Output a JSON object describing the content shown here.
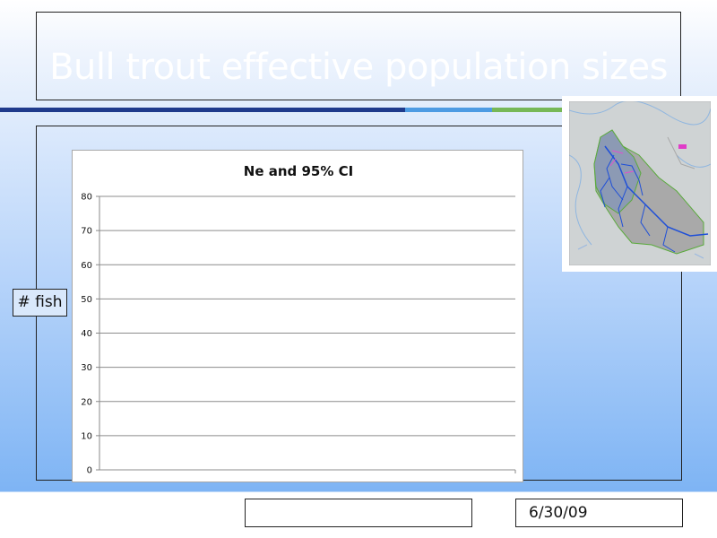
{
  "slide": {
    "title": "Bull trout effective population sizes",
    "ylabel_callout": "# fish",
    "footer_text": "",
    "date": "6/30/09"
  },
  "colors": {
    "title_text": "#ffffff",
    "rule_dark": "#1f3a8c",
    "rule_mid": "#4d9be3",
    "rule_green": "#77b857",
    "gridline": "#8c8c8c"
  },
  "map": {
    "icon": "watershed-map-image"
  },
  "chart_data": {
    "type": "bar",
    "title": "Ne and 95% CI",
    "xlabel": "",
    "ylabel": "",
    "categories": [],
    "series": [],
    "ylim": [
      0,
      80
    ],
    "yticks": [
      0,
      10,
      20,
      30,
      40,
      50,
      60,
      70,
      80
    ],
    "grid": true,
    "legend": "none"
  }
}
